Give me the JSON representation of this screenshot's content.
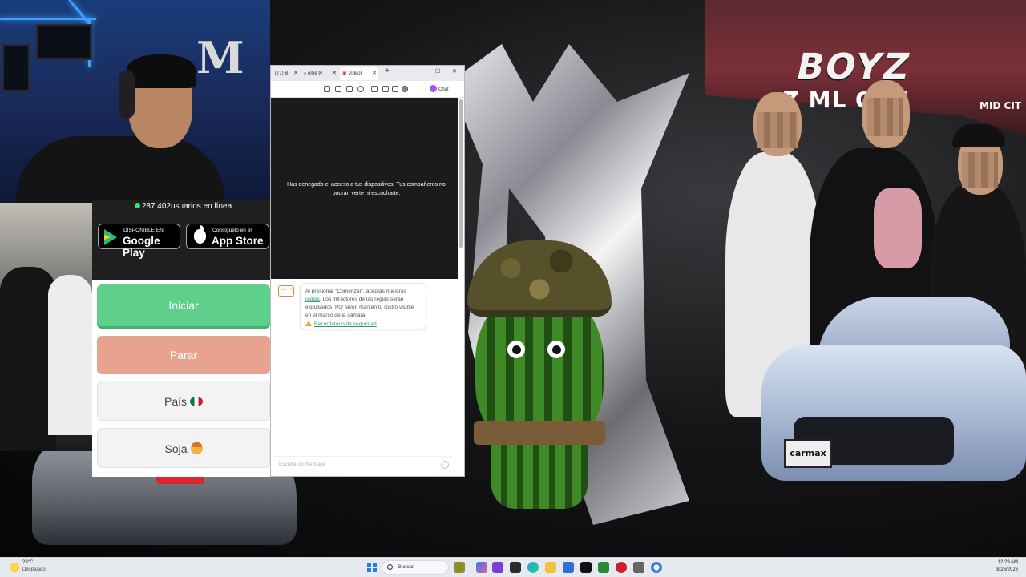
{
  "background": {
    "tent_text": "BOYZ",
    "tent_sub": "Z    ML    OYZ",
    "tent_sub2": "MID CIT",
    "car_plate": "carmax"
  },
  "omegle": {
    "online_count": "287.402",
    "online_label": "usuarios en línea",
    "google_play": {
      "small": "DISPONIBLE EN",
      "big": "Google Play"
    },
    "app_store": {
      "small": "Consíguelo en el",
      "big": "App Store"
    },
    "start_label": "Iniciar",
    "stop_label": "Parar",
    "country_label": "País",
    "gender_label": "Soja"
  },
  "browser": {
    "tabs": [
      {
        "label": "(77) B·"
      },
      {
        "label": "ome tv"
      },
      {
        "label": "Videoll"
      }
    ],
    "new_tab": "+",
    "window_controls": [
      "—",
      "☐",
      "✕"
    ],
    "chat_label": "Chat",
    "denied_message": "Has denegado el acceso a tus dispositivos. Tus compañeros no podrán verte ni escucharte.",
    "bot_avatar_text": "Ome TV",
    "rules_pre": "Al presionar \"Comenzar\", aceptas nuestras ",
    "rules_link": "reglas",
    "rules_post": ". Los infractores de las reglas serán expulsados. Por favor, mantén tu rostro visible en el marco de la cámara.",
    "safety_link": "Recordatorio de seguridad",
    "input_placeholder": "Escribe un mensaje"
  },
  "taskbar": {
    "temperature": "23°C",
    "weather": "Despejado",
    "search_label": "Buscar",
    "time": "12:29 AM",
    "date": "8/26/2026"
  }
}
